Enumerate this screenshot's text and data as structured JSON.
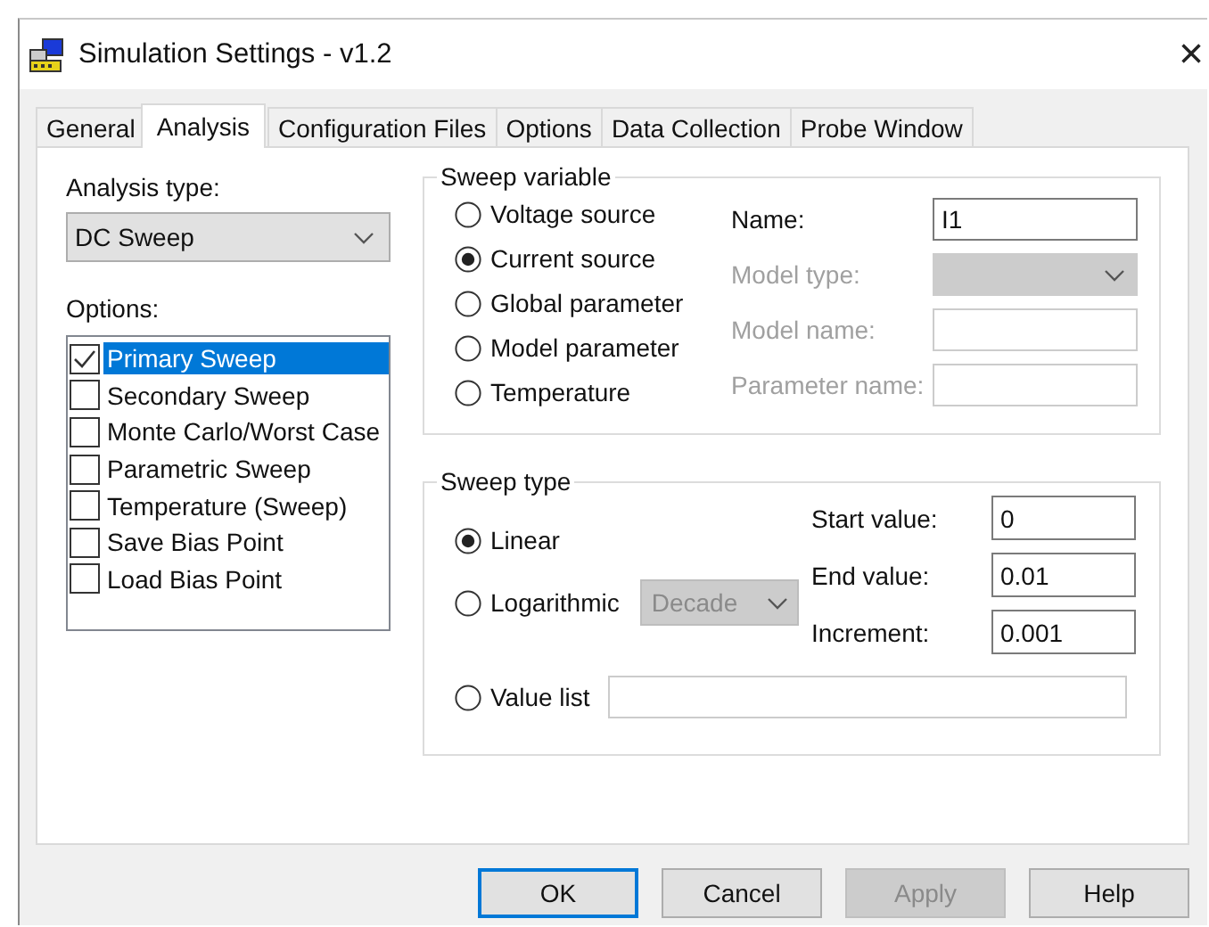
{
  "window": {
    "title": "Simulation Settings - v1.2",
    "close": "×"
  },
  "tabs": [
    {
      "label": "General",
      "selected": false
    },
    {
      "label": "Analysis",
      "selected": true
    },
    {
      "label": "Configuration Files",
      "selected": false
    },
    {
      "label": "Options",
      "selected": false
    },
    {
      "label": "Data Collection",
      "selected": false
    },
    {
      "label": "Probe Window",
      "selected": false
    }
  ],
  "analysis_type": {
    "label": "Analysis type:",
    "value": "DC Sweep"
  },
  "options": {
    "label": "Options:",
    "items": [
      {
        "label": "Primary Sweep",
        "checked": true,
        "selected": true
      },
      {
        "label": "Secondary Sweep",
        "checked": false,
        "selected": false
      },
      {
        "label": "Monte Carlo/Worst Case",
        "checked": false,
        "selected": false
      },
      {
        "label": "Parametric Sweep",
        "checked": false,
        "selected": false
      },
      {
        "label": "Temperature (Sweep)",
        "checked": false,
        "selected": false
      },
      {
        "label": "Save Bias Point",
        "checked": false,
        "selected": false
      },
      {
        "label": "Load Bias Point",
        "checked": false,
        "selected": false
      }
    ]
  },
  "sweep_variable": {
    "title": "Sweep variable",
    "sources": [
      {
        "label": "Voltage source",
        "selected": false
      },
      {
        "label": "Current source",
        "selected": true
      },
      {
        "label": "Global parameter",
        "selected": false
      },
      {
        "label": "Model parameter",
        "selected": false
      },
      {
        "label": "Temperature",
        "selected": false
      }
    ],
    "fields": [
      {
        "kind": "text",
        "label": "Name:",
        "value": "I1",
        "disabled": false
      },
      {
        "kind": "select",
        "label": "Model type:",
        "disabled": true
      },
      {
        "kind": "text",
        "label": "Model name:",
        "disabled": true
      },
      {
        "kind": "text",
        "label": "Parameter name:",
        "disabled": true
      }
    ]
  },
  "sweep_type": {
    "title": "Sweep type",
    "modes": [
      {
        "kind": "plain",
        "label": "Linear",
        "selected": true
      },
      {
        "kind": "dropdown",
        "label": "Logarithmic",
        "selected": false,
        "dropdown": {
          "value": "Decade",
          "disabled": true
        }
      },
      {
        "kind": "field",
        "label": "Value list",
        "selected": false
      }
    ],
    "fields": [
      {
        "label": "Start value:",
        "value": "0"
      },
      {
        "label": "End value:",
        "value": "0.01"
      },
      {
        "label": "Increment:",
        "value": "0.001"
      }
    ]
  },
  "buttons": [
    {
      "label": "OK",
      "default": true,
      "disabled": false
    },
    {
      "label": "Cancel",
      "default": false,
      "disabled": false
    },
    {
      "label": "Apply",
      "default": false,
      "disabled": true
    },
    {
      "label": "Help",
      "default": false,
      "disabled": false
    }
  ]
}
